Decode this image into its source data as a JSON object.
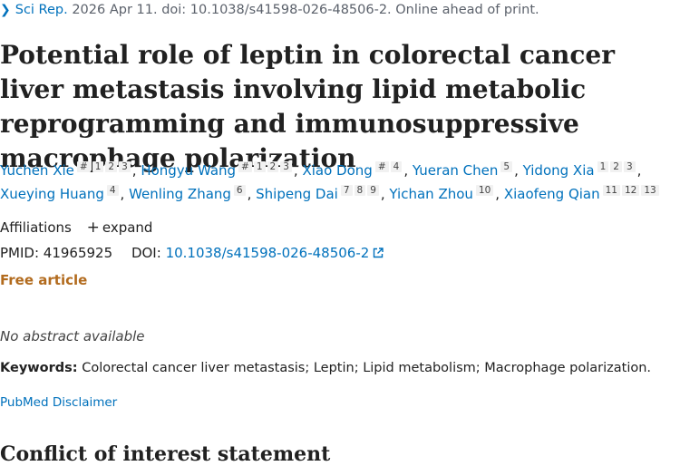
{
  "citation": {
    "journal": "Sci Rep.",
    "text": "2026 Apr 11. doi: 10.1038/s41598-026-48506-2. Online ahead of print."
  },
  "title": "Potential role of leptin in colorectal cancer liver metastasis involving lipid metabolic reprogramming and immunosuppressive macrophage polarization",
  "authors": [
    {
      "name": "Yuchen Xie",
      "sups": [
        "#",
        "1",
        "2",
        "3"
      ]
    },
    {
      "name": "Hongyu Wang",
      "sups": [
        "#",
        "1",
        "2",
        "3"
      ]
    },
    {
      "name": "Xiao Dong",
      "sups": [
        "#",
        "4"
      ]
    },
    {
      "name": "Yueran Chen",
      "sups": [
        "5"
      ]
    },
    {
      "name": "Yidong Xia",
      "sups": [
        "1",
        "2",
        "3"
      ]
    },
    {
      "name": "Xueying Huang",
      "sups": [
        "4"
      ]
    },
    {
      "name": "Wenling Zhang",
      "sups": [
        "6"
      ]
    },
    {
      "name": "Shipeng Dai",
      "sups": [
        "7",
        "8",
        "9"
      ]
    },
    {
      "name": "Yichan Zhou",
      "sups": [
        "10"
      ]
    },
    {
      "name": "Xiaofeng Qian",
      "sups": [
        "11",
        "12",
        "13"
      ]
    }
  ],
  "affiliations": {
    "label": "Affiliations",
    "expand": "expand"
  },
  "ids": {
    "pmid_label": "PMID:",
    "pmid": "41965925",
    "doi_label": "DOI:",
    "doi": "10.1038/s41598-026-48506-2"
  },
  "free_article": "Free article",
  "no_abstract": "No abstract available",
  "keywords": {
    "label": "Keywords:",
    "text": "Colorectal cancer liver metastasis; Leptin; Lipid metabolism; Macrophage polarization."
  },
  "disclaimer": "PubMed Disclaimer",
  "coi_heading": "Conflict of interest statement",
  "icons": {
    "citation": "chevron-right-icon",
    "expand": "plus-icon",
    "doi": "external-link-icon"
  },
  "colors": {
    "link": "#0071bc",
    "free_article": "#b26b1e",
    "text": "#212121"
  }
}
